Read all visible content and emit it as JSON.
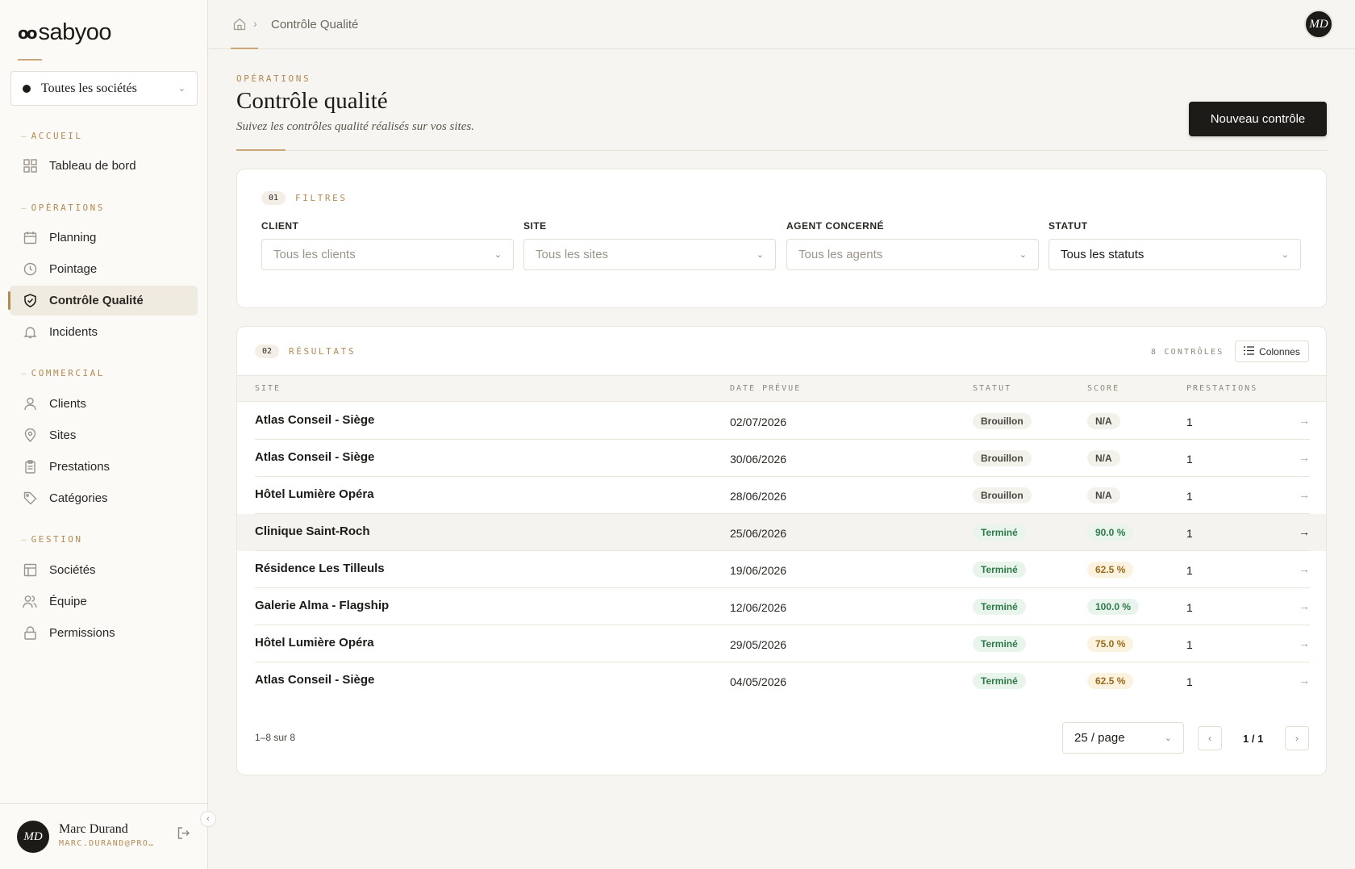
{
  "brand": {
    "name": "sabyoo",
    "mark": "oo"
  },
  "company_selector": {
    "value": "Toutes les sociétés"
  },
  "sidebar": {
    "sections": [
      {
        "label": "ACCUEIL",
        "items": [
          {
            "label": "Tableau de bord",
            "icon": "dashboard-icon"
          }
        ]
      },
      {
        "label": "OPÉRATIONS",
        "items": [
          {
            "label": "Planning",
            "icon": "calendar-icon"
          },
          {
            "label": "Pointage",
            "icon": "clock-icon"
          },
          {
            "label": "Contrôle Qualité",
            "icon": "shield-check-icon",
            "active": true
          },
          {
            "label": "Incidents",
            "icon": "bell-icon"
          }
        ]
      },
      {
        "label": "COMMERCIAL",
        "items": [
          {
            "label": "Clients",
            "icon": "user-icon"
          },
          {
            "label": "Sites",
            "icon": "map-pin-icon"
          },
          {
            "label": "Prestations",
            "icon": "clipboard-icon"
          },
          {
            "label": "Catégories",
            "icon": "tag-icon"
          }
        ]
      },
      {
        "label": "GESTION",
        "items": [
          {
            "label": "Sociétés",
            "icon": "building-icon"
          },
          {
            "label": "Équipe",
            "icon": "users-icon"
          },
          {
            "label": "Permissions",
            "icon": "lock-icon"
          }
        ]
      }
    ],
    "user": {
      "initials": "MD",
      "name": "Marc Durand",
      "email": "MARC.DURAND@PRO…"
    }
  },
  "topbar": {
    "breadcrumb": "Contrôle Qualité",
    "avatar_initials": "MD"
  },
  "header": {
    "eyebrow": "OPÉRATIONS",
    "title": "Contrôle qualité",
    "subtitle": "Suivez les contrôles qualité réalisés sur vos sites.",
    "primary_action": "Nouveau contrôle"
  },
  "filters": {
    "step": "01",
    "title": "FILTRES",
    "fields": [
      {
        "label": "CLIENT",
        "value": "Tous les clients"
      },
      {
        "label": "SITE",
        "value": "Tous les sites"
      },
      {
        "label": "AGENT CONCERNÉ",
        "value": "Tous les agents"
      },
      {
        "label": "STATUT",
        "value": "Tous les statuts"
      }
    ]
  },
  "results": {
    "step": "02",
    "title": "RÉSULTATS",
    "count_label": "8 CONTRÔLES",
    "columns_button": "Colonnes",
    "columns": [
      "SITE",
      "DATE PRÉVUE",
      "STATUT",
      "SCORE",
      "PRESTATIONS"
    ],
    "rows": [
      {
        "site": "Atlas Conseil - Siège",
        "date": "02/07/2026",
        "status": "Brouillon",
        "score": "N/A",
        "prestations": "1"
      },
      {
        "site": "Atlas Conseil - Siège",
        "date": "30/06/2026",
        "status": "Brouillon",
        "score": "N/A",
        "prestations": "1"
      },
      {
        "site": "Hôtel Lumière Opéra",
        "date": "28/06/2026",
        "status": "Brouillon",
        "score": "N/A",
        "prestations": "1"
      },
      {
        "site": "Clinique Saint-Roch",
        "date": "25/06/2026",
        "status": "Terminé",
        "score": "90.0 %",
        "prestations": "1"
      },
      {
        "site": "Résidence Les Tilleuls",
        "date": "19/06/2026",
        "status": "Terminé",
        "score": "62.5 %",
        "prestations": "1"
      },
      {
        "site": "Galerie Alma - Flagship",
        "date": "12/06/2026",
        "status": "Terminé",
        "score": "100.0 %",
        "prestations": "1"
      },
      {
        "site": "Hôtel Lumière Opéra",
        "date": "29/05/2026",
        "status": "Terminé",
        "score": "75.0 %",
        "prestations": "1"
      },
      {
        "site": "Atlas Conseil - Siège",
        "date": "04/05/2026",
        "status": "Terminé",
        "score": "62.5 %",
        "prestations": "1"
      }
    ],
    "range_label": "1–8 sur 8",
    "per_page": "25 / page",
    "page_label": "1 / 1"
  },
  "colors": {
    "accent": "#b48a53",
    "dark": "#1d1b18",
    "success": "#2f7a49",
    "warning": "#9a6b1c"
  }
}
